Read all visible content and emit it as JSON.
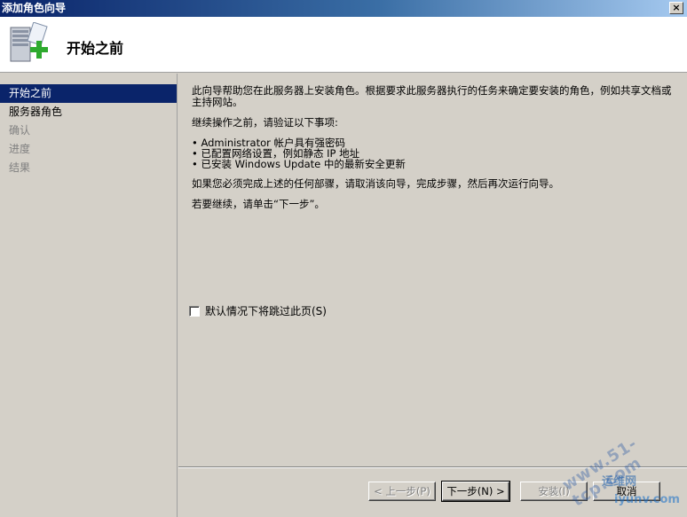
{
  "window": {
    "title": "添加角色向导",
    "close_label": "×"
  },
  "header": {
    "title": "开始之前",
    "icon": "server-add-icon"
  },
  "sidebar": {
    "items": [
      {
        "label": "开始之前",
        "state": "active"
      },
      {
        "label": "服务器角色",
        "state": "enabled"
      },
      {
        "label": "确认",
        "state": "disabled"
      },
      {
        "label": "进度",
        "state": "disabled"
      },
      {
        "label": "结果",
        "state": "disabled"
      }
    ]
  },
  "content": {
    "intro": "此向导帮助您在此服务器上安装角色。根据要求此服务器执行的任务来确定要安装的角色，例如共享文档或主持网站。",
    "verify_heading": "继续操作之前，请验证以下事项:",
    "bullets": [
      "Administrator 帐户具有强密码",
      "已配置网络设置，例如静态 IP 地址",
      "已安装 Windows Update 中的最新安全更新"
    ],
    "cancel_note": "如果您必须完成上述的任何部骤，请取消该向导，完成步骤，然后再次运行向导。",
    "continue_note": "若要继续，请单击“下一步”。"
  },
  "skip": {
    "label": "默认情况下将跳过此页(S)",
    "checked": false
  },
  "buttons": {
    "prev": "< 上一步(P)",
    "next": "下一步(N) >",
    "install": "安装(I)",
    "cancel": "取消"
  },
  "watermark": {
    "line": "www.51-tcp.com",
    "badge": "运维网",
    "sub": "iyunv.com"
  }
}
